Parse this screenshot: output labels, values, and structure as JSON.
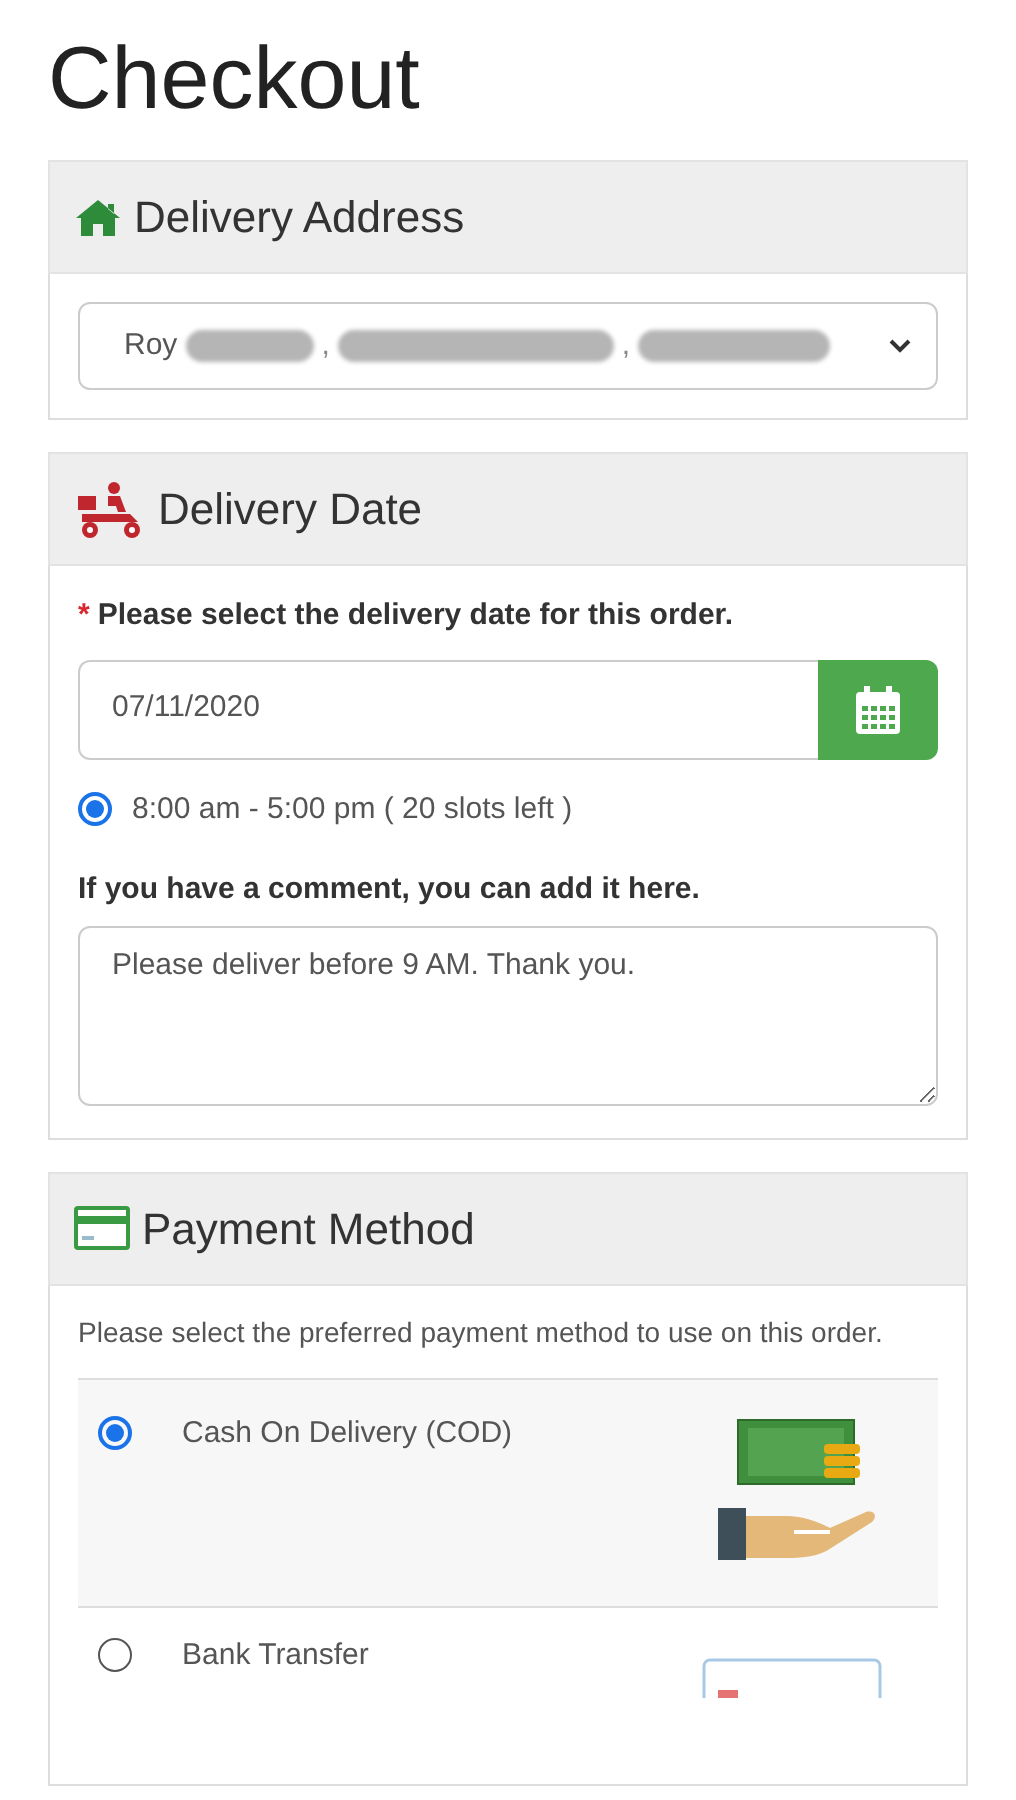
{
  "title": "Checkout",
  "delivery_address": {
    "heading": "Delivery Address",
    "select": {
      "visible_text": "Roy",
      "separator": ",",
      "redacted": true
    }
  },
  "delivery_date": {
    "heading": "Delivery Date",
    "required_mark": "*",
    "prompt": "Please select the delivery date for this order.",
    "date_field": {
      "value": "07/11/2020"
    },
    "slots": [
      {
        "label": "8:00 am - 5:00 pm ( 20 slots left )",
        "selected": true
      }
    ],
    "comment_label": "If you have a comment, you can add it here.",
    "comment": {
      "value": "Please deliver before 9 AM. Thank you."
    }
  },
  "payment_method": {
    "heading": "Payment Method",
    "prompt": "Please select the preferred payment method to use on this order.",
    "options": [
      {
        "label": "Cash On Delivery (COD)",
        "selected": true,
        "kind": "cash"
      },
      {
        "label": "Bank Transfer",
        "selected": false,
        "kind": "bank"
      }
    ]
  }
}
